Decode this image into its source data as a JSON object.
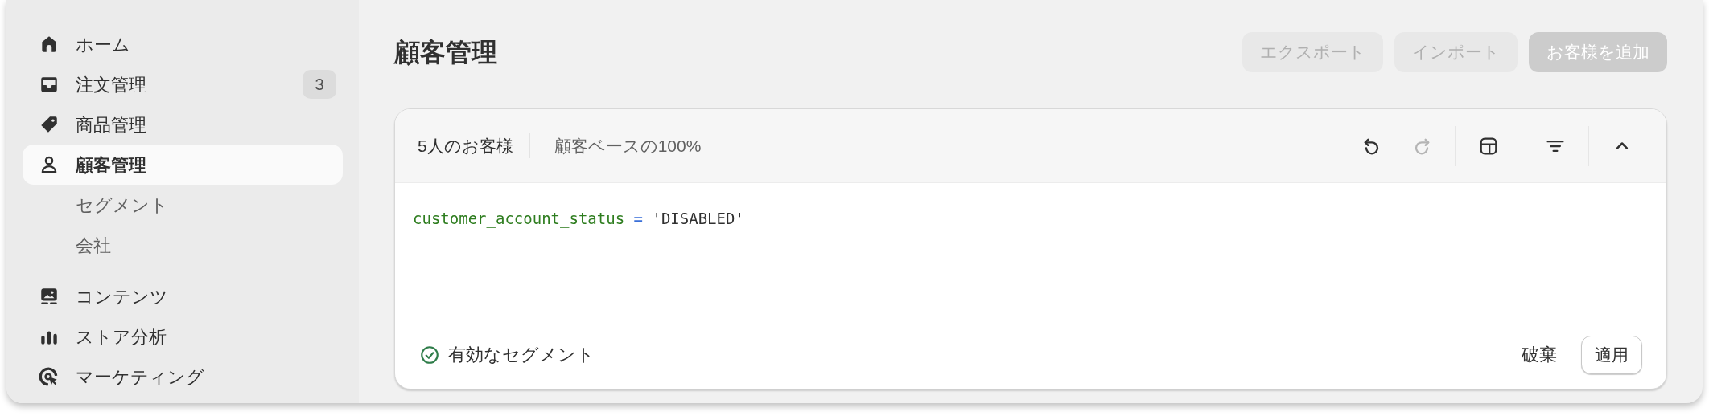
{
  "sidebar": {
    "items": [
      {
        "label": "ホーム",
        "selected": false
      },
      {
        "label": "注文管理",
        "selected": false,
        "badge": "3"
      },
      {
        "label": "商品管理",
        "selected": false
      },
      {
        "label": "顧客管理",
        "selected": true,
        "children": [
          {
            "label": "セグメント",
            "selected": false
          },
          {
            "label": "会社",
            "selected": false
          }
        ]
      },
      {
        "label": "コンテンツ",
        "selected": false
      },
      {
        "label": "ストア分析",
        "selected": false
      },
      {
        "label": "マーケティング",
        "selected": false
      }
    ]
  },
  "page": {
    "title": "顧客管理",
    "actions": [
      {
        "label": "エクスポート",
        "kind": "secondary",
        "disabled": true
      },
      {
        "label": "インポート",
        "kind": "secondary",
        "disabled": true
      },
      {
        "label": "お客様を追加",
        "kind": "primary",
        "disabled": true
      }
    ]
  },
  "segment_editor": {
    "stats": [
      "5人のお客様",
      "顧客ベースの100%"
    ],
    "tools": [
      {
        "kind": "undo",
        "disabled": false
      },
      {
        "kind": "redo",
        "disabled": true
      },
      {
        "kind": "layout",
        "disabled": false
      },
      {
        "kind": "filter",
        "disabled": false
      },
      {
        "kind": "collapse",
        "disabled": false
      }
    ],
    "query": [
      {
        "text": "customer_account_status",
        "kind": "field"
      },
      {
        "text": "=",
        "kind": "operator"
      },
      {
        "text": "'DISABLED'",
        "kind": "string"
      }
    ],
    "status": {
      "text": "有効なセグメント",
      "valid": true
    },
    "discard": "破棄",
    "apply": "適用"
  }
}
